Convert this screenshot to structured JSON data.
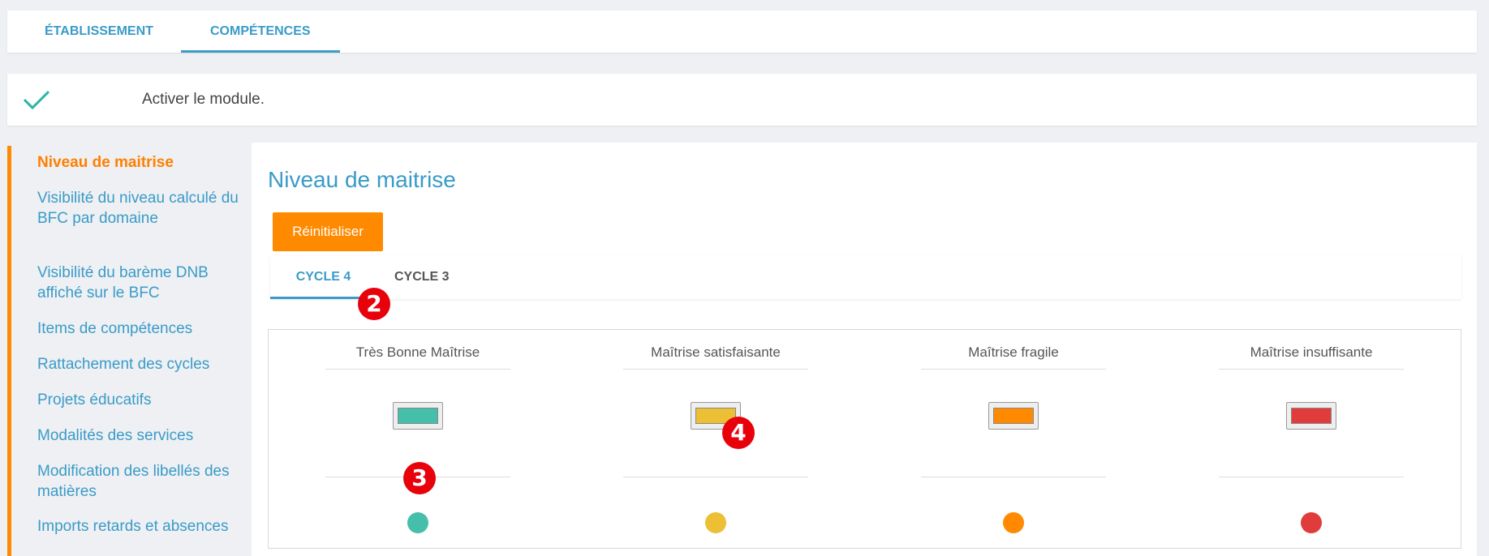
{
  "top_tabs": [
    {
      "label": "ÉTABLISSEMENT",
      "active": false
    },
    {
      "label": "COMPÉTENCES",
      "active": true
    }
  ],
  "module": {
    "label": "Activer le module.",
    "icon": "check-icon",
    "color": "#2ab5a6"
  },
  "sidebar": {
    "items": [
      {
        "label": "Niveau de maitrise",
        "active": true
      },
      {
        "label": "Visibilité du niveau calculé du BFC par domaine"
      },
      {
        "label": "Visibilité du barème DNB affiché sur le BFC"
      },
      {
        "label": "Items de compétences"
      },
      {
        "label": "Rattachement des cycles"
      },
      {
        "label": "Projets éducatifs"
      },
      {
        "label": "Modalités des services"
      },
      {
        "label": "Modification des libellés des matières"
      },
      {
        "label": "Imports retards et absences"
      }
    ]
  },
  "main": {
    "title": "Niveau de maitrise",
    "reset_label": "Réinitialiser",
    "cycle_tabs": [
      {
        "label": "CYCLE 4",
        "active": true
      },
      {
        "label": "CYCLE 3",
        "active": false
      }
    ],
    "levels": [
      {
        "name": "Très Bonne Maîtrise",
        "color": "#46bfaa"
      },
      {
        "name": "Maîtrise satisfaisante",
        "color": "#ecbf34"
      },
      {
        "name": "Maîtrise fragile",
        "color": "#ff8a00"
      },
      {
        "name": "Maîtrise insuffisante",
        "color": "#e13c3c"
      }
    ]
  },
  "markers": [
    "2",
    "3",
    "4"
  ]
}
